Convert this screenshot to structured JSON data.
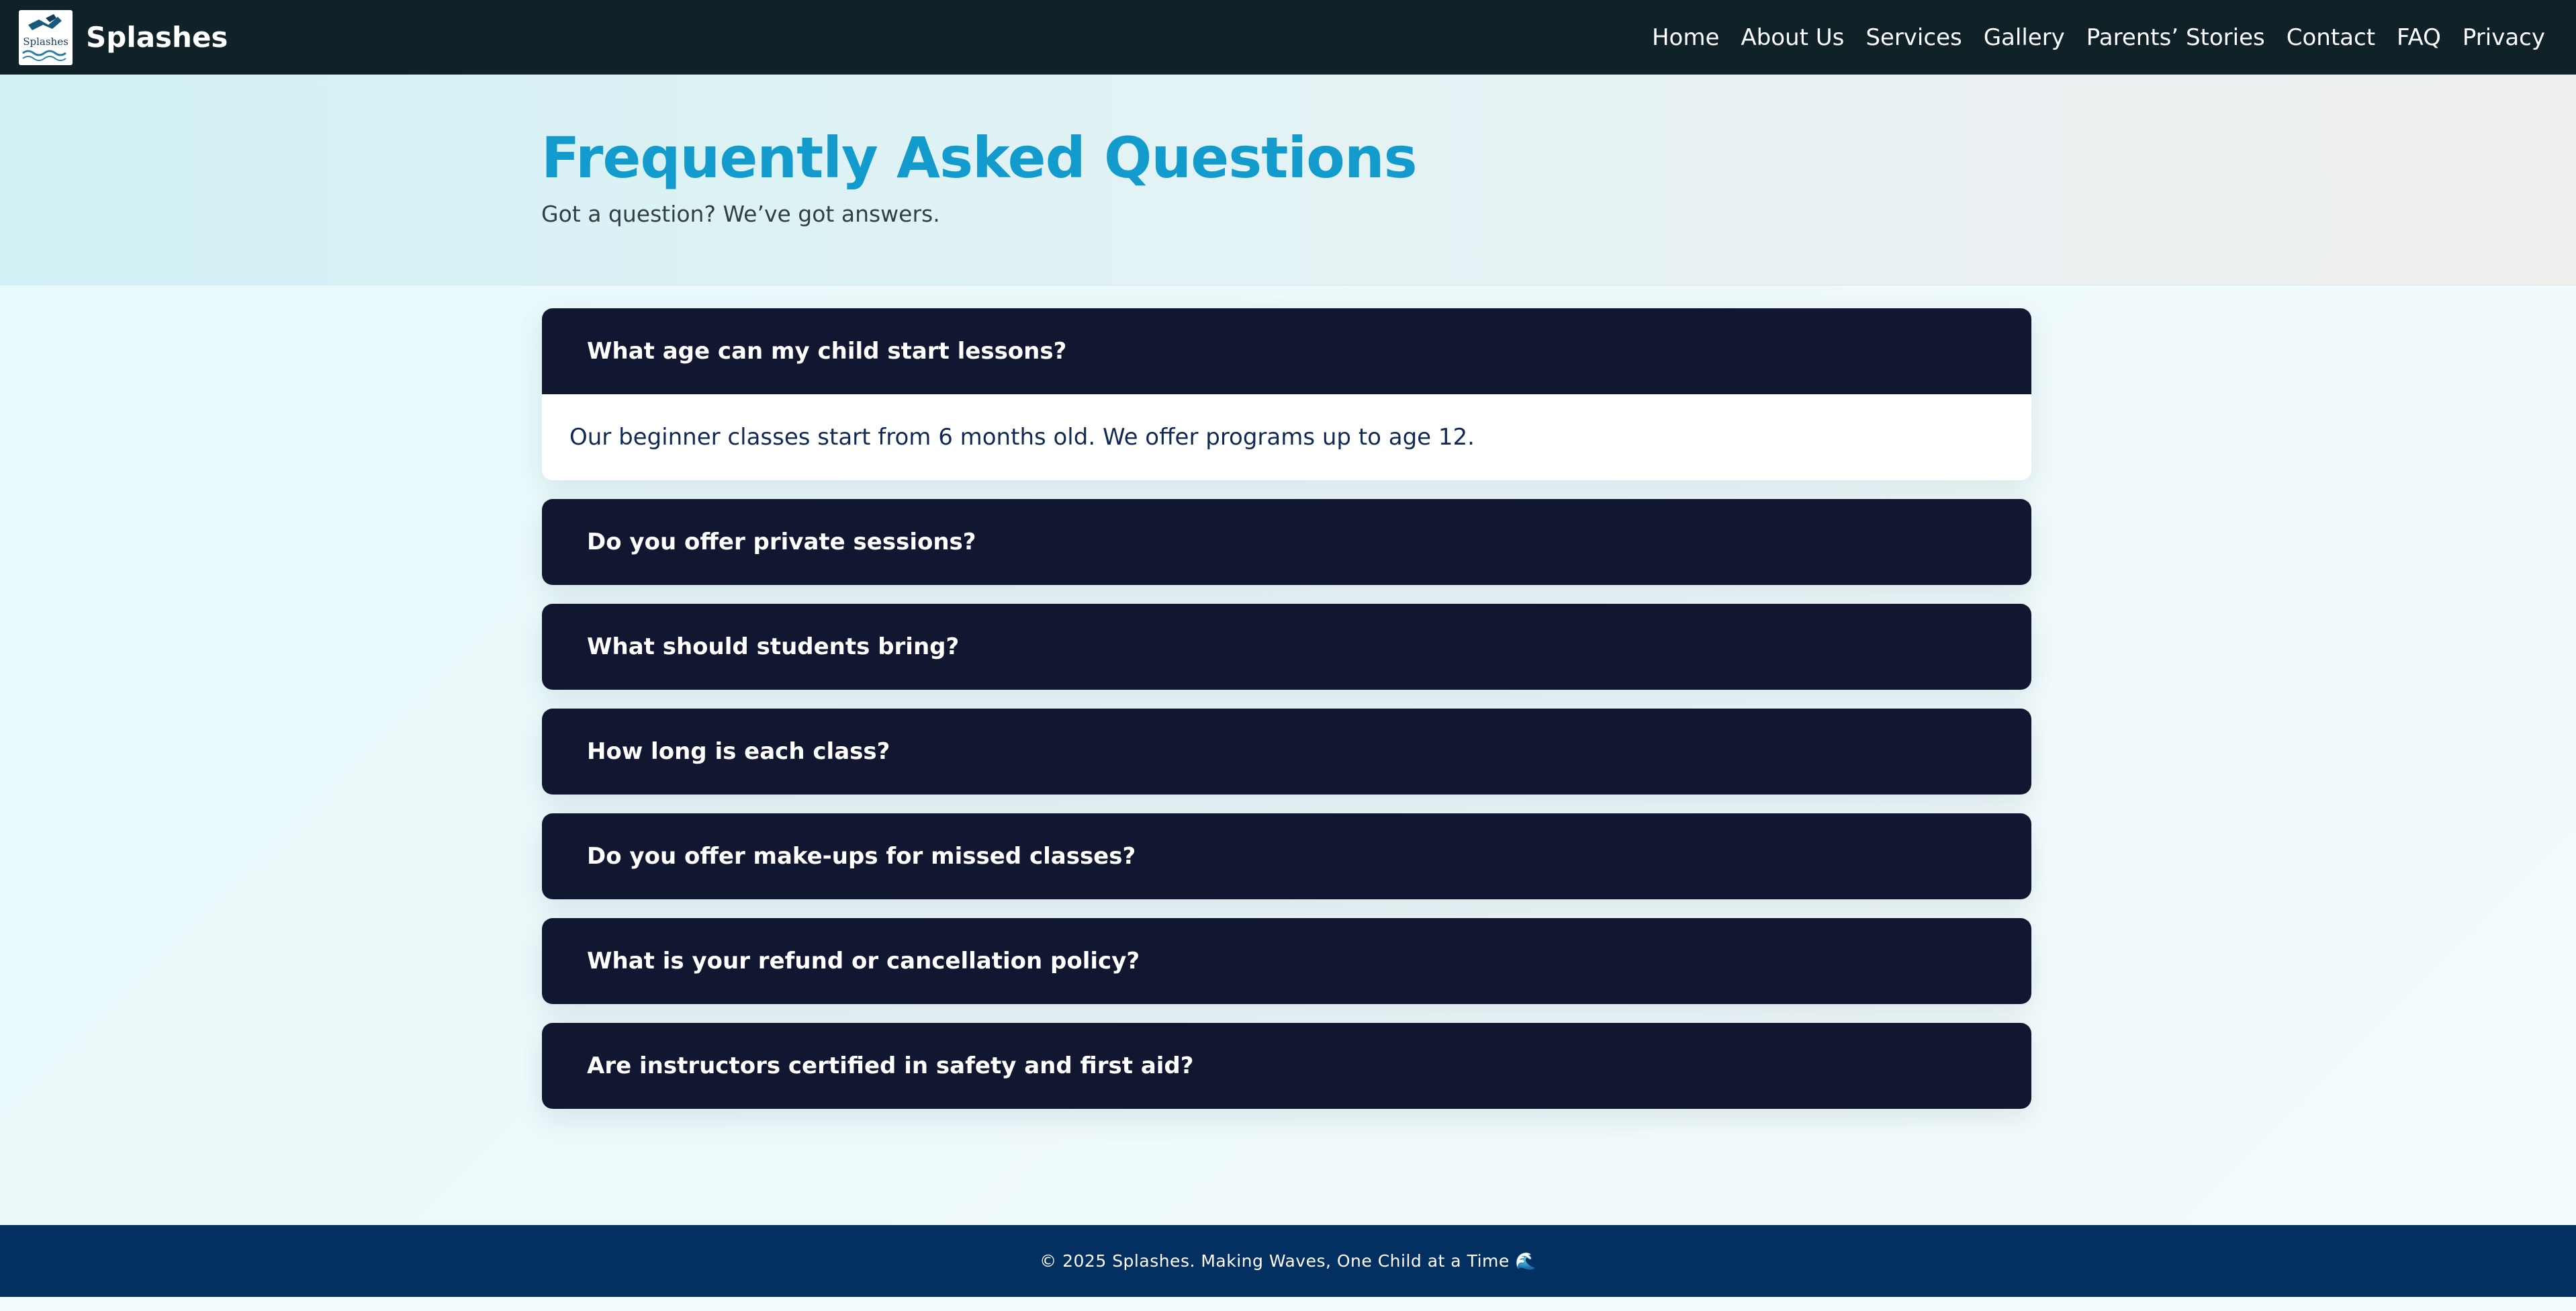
{
  "header": {
    "brand": "Splashes",
    "logo_text": "Splashes",
    "nav": [
      {
        "label": "Home"
      },
      {
        "label": "About Us"
      },
      {
        "label": "Services"
      },
      {
        "label": "Gallery"
      },
      {
        "label": "Parents’ Stories"
      },
      {
        "label": "Contact"
      },
      {
        "label": "FAQ"
      },
      {
        "label": "Privacy"
      }
    ]
  },
  "hero": {
    "title": "Frequently Asked Questions",
    "subtitle": "Got a question? We’ve got answers."
  },
  "faq": [
    {
      "question": "What age can my child start lessons?",
      "answer": "Our beginner classes start from 6 months old. We offer programs up to age 12.",
      "expanded": true
    },
    {
      "question": "Do you offer private sessions?",
      "expanded": false
    },
    {
      "question": "What should students bring?",
      "expanded": false
    },
    {
      "question": "How long is each class?",
      "expanded": false
    },
    {
      "question": "Do you offer make-ups for missed classes?",
      "expanded": false
    },
    {
      "question": "What is your refund or cancellation policy?",
      "expanded": false
    },
    {
      "question": "Are instructors certified in safety and first aid?",
      "expanded": false
    }
  ],
  "footer": {
    "text": "© 2025 Splashes. Making Waves, One Child at a Time 🌊"
  },
  "colors": {
    "nav_bg": "#102127",
    "accent": "#129bcc",
    "question_bg": "#111730",
    "footer_bg": "#032f61"
  }
}
